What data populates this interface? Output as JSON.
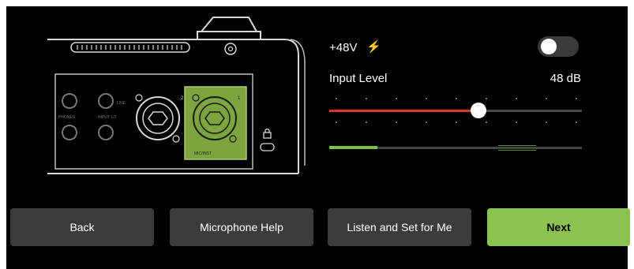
{
  "phantom_power": {
    "label": "+48V",
    "icon": "lightning-bolt-icon",
    "icon_color": "#f5b800",
    "enabled": false
  },
  "input_level": {
    "label": "Input Level",
    "value_text": "48 dB",
    "slider_fraction": 0.59,
    "slider_color": "#e0322d",
    "meter_level": 0.19,
    "meter_color": "#7ac142"
  },
  "device": {
    "phones_label": "PHONES",
    "input_label": "INPUT 1/2",
    "line_label": "LINE",
    "input_2_number": "2",
    "input_1_number": "1",
    "mic_label": "MIC/INST",
    "highlight_color": "#7da43f"
  },
  "buttons": {
    "back": "Back",
    "microphone_help": "Microphone Help",
    "listen_and_set": "Listen and Set for Me",
    "next": "Next",
    "next_color": "#8cc350"
  }
}
